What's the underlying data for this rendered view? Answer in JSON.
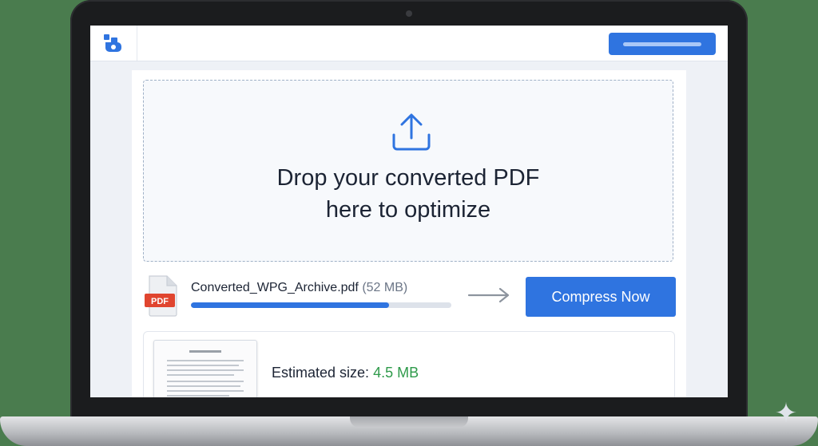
{
  "header": {
    "logo_icon": "app-logo-icon",
    "action_button_icon": "placeholder-bar"
  },
  "dropzone": {
    "icon": "upload-icon",
    "line1": "Drop your converted PDF",
    "line2": "here to optimize"
  },
  "file": {
    "icon": "pdf-file-icon",
    "badge": "PDF",
    "name": "Converted_WPG_Archive.pdf",
    "size": "(52 MB)",
    "progress_percent": 76
  },
  "compress_button": {
    "label": "Compress Now"
  },
  "estimate": {
    "label": "Estimated size:",
    "value": "4.5 MB"
  },
  "colors": {
    "accent": "#2f74e0",
    "success": "#2e9a4a",
    "pdf_badge": "#e0452f"
  }
}
